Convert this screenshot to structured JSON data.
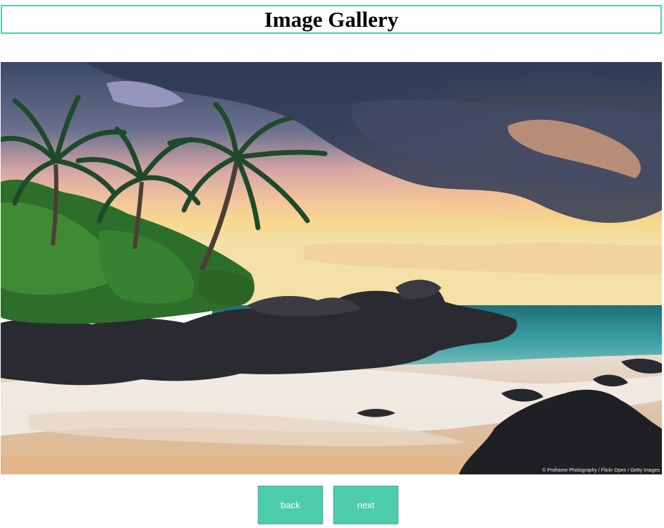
{
  "header": {
    "title": "Image Gallery"
  },
  "gallery": {
    "image_alt": "Tropical beach with palm trees at sunset",
    "credit": "© Proframe Photography / Flickr Open / Getty Images"
  },
  "controls": {
    "back_label": "back",
    "next_label": "next"
  },
  "colors": {
    "accent": "#4dcdac",
    "title_border": "#4fcdae"
  }
}
